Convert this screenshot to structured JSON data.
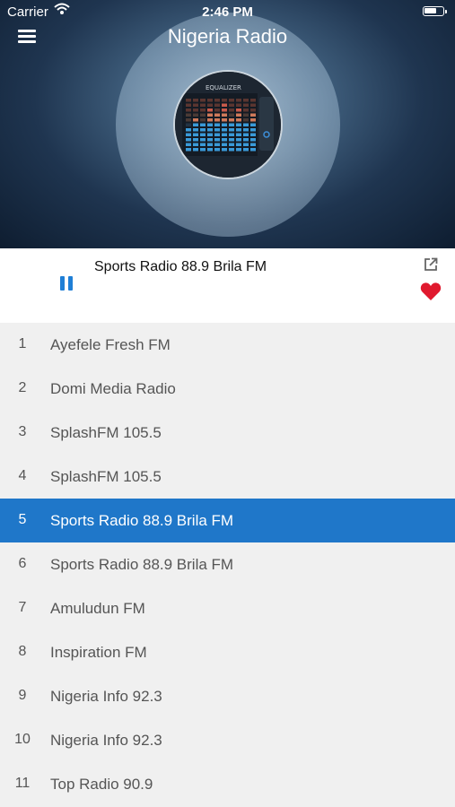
{
  "status_bar": {
    "carrier": "Carrier",
    "time": "2:46 PM"
  },
  "header": {
    "title": "Nigeria Radio",
    "artwork_label": "EQUALIZER",
    "menu_icon": "hamburger-menu-icon"
  },
  "player": {
    "now_playing": "Sports Radio 88.9 Brila FM",
    "state": "playing",
    "controls": {
      "pause_icon": "pause-icon",
      "share_icon": "share-external-icon",
      "favorite_icon": "heart-icon"
    },
    "favorite": true
  },
  "colors": {
    "accent": "#1f77c9",
    "favorite": "#e0192e"
  },
  "stations": [
    {
      "num": "1",
      "name": "Ayefele Fresh FM"
    },
    {
      "num": "2",
      "name": "Domi Media Radio"
    },
    {
      "num": "3",
      "name": "SplashFM 105.5"
    },
    {
      "num": "4",
      "name": "SplashFM 105.5"
    },
    {
      "num": "5",
      "name": "Sports Radio 88.9 Brila FM",
      "selected": true
    },
    {
      "num": "6",
      "name": "Sports Radio 88.9 Brila FM"
    },
    {
      "num": "7",
      "name": "Amuludun FM"
    },
    {
      "num": "8",
      "name": "Inspiration FM"
    },
    {
      "num": "9",
      "name": "Nigeria Info 92.3"
    },
    {
      "num": "10",
      "name": "Nigeria Info 92.3"
    },
    {
      "num": "11",
      "name": "Top Radio 90.9"
    }
  ]
}
